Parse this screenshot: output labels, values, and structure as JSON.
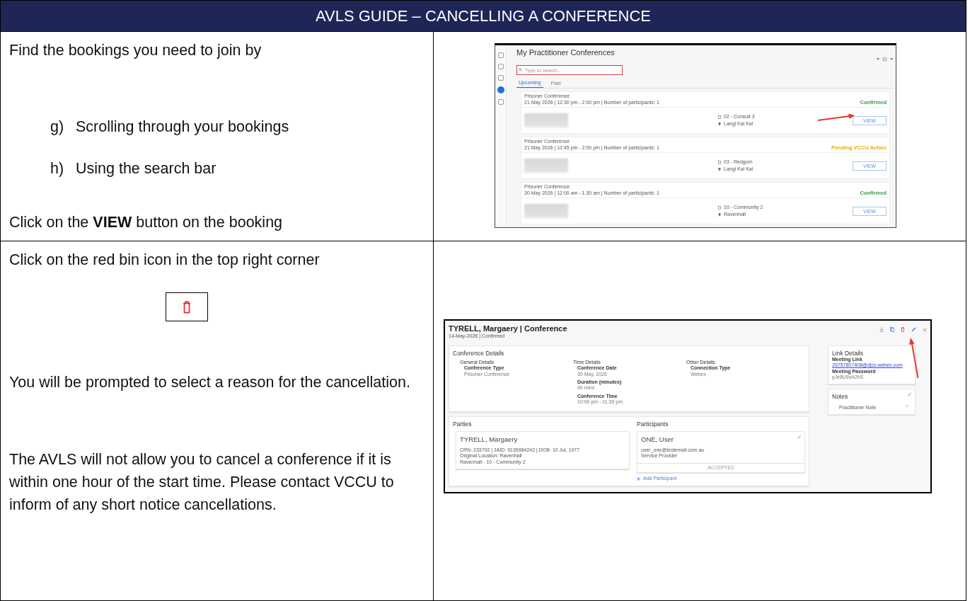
{
  "header": {
    "title": "AVLS GUIDE – CANCELLING A CONFERENCE"
  },
  "guide_rows": [
    {
      "instructions": [
        {
          "kind": "text",
          "text": "Find the bookings you need to join by"
        },
        {
          "kind": "list_item",
          "marker": "g)",
          "text": "Scrolling through your bookings"
        },
        {
          "kind": "list_item",
          "marker": "h)",
          "text": "Using the search bar"
        },
        {
          "kind": "text",
          "text": "Click on the **VIEW** button on the booking"
        }
      ],
      "screenshot": {
        "kind": "bookings",
        "title": "My Practitioner Conferences",
        "search_placeholder": "Type to search...",
        "sidebar": [
          {
            "selected": false
          },
          {
            "selected": false
          },
          {
            "selected": false
          },
          {
            "selected": true
          },
          {
            "selected": false
          }
        ],
        "tabs": [
          {
            "label": "Upcoming",
            "selected": true
          },
          {
            "label": "Past",
            "selected": false
          }
        ],
        "bookings": [
          {
            "type": "Prisoner Conference",
            "when": "21 May 2026 | 12:30 pm - 2:00 pm | Number of participants: 1",
            "status": "Confirmed",
            "color": "#3a9b46",
            "room": "02 - Consult 3",
            "site": "Langi Kal Kal",
            "button": "VIEW",
            "highlighted": true
          },
          {
            "type": "Prisoner Conference",
            "when": "21 May 2026 | 12:45 pm - 2:00 pm | Number of participants: 1",
            "status": "Pending VCCU Action",
            "color": "#f0a800",
            "room": "03 - Redgum",
            "site": "Langi Kal Kal",
            "button": "VIEW",
            "highlighted": false
          },
          {
            "type": "Prisoner Conference",
            "when": "30 May 2026 | 12:00 am - 1:30 am | Number of participants: 1",
            "status": "Confirmed",
            "color": "#3a9b46",
            "room": "10 - Community 2",
            "site": "Ravenhall",
            "button": "VIEW",
            "highlighted": false
          }
        ]
      }
    },
    {
      "instructions": [
        {
          "kind": "text",
          "text": "Click on the red bin icon in the top right corner"
        },
        {
          "kind": "bin_icon"
        },
        {
          "kind": "text",
          "text": "You will be prompted to select a reason for the cancellation."
        },
        {
          "kind": "text",
          "text": "The AVLS will not allow you to cancel a conference if it is within one hour of the start time. Please contact VCCU to inform of any short notice cancellations."
        }
      ],
      "screenshot": {
        "kind": "conference",
        "title": "TYRELL, Margaery | Conference",
        "subtitle": "14-May-2026 | Confirmed",
        "delete_highlighted": true,
        "conference_details": {
          "title": "Conference Details",
          "groups": [
            {
              "title": "General Details",
              "fields": [
                {
                  "label": "Conference Type",
                  "value": "Prisoner Conference"
                }
              ]
            },
            {
              "title": "Time Details",
              "fields": [
                {
                  "label": "Conference Date",
                  "value": "30 May, 2026"
                },
                {
                  "label": "Duration (minutes)",
                  "value": "90 mins"
                },
                {
                  "label": "Conference Time",
                  "value": "10:00 pm - 11:30 pm"
                }
              ]
            },
            {
              "title": "Other Details",
              "fields": [
                {
                  "label": "Connection Type",
                  "value": "Webex"
                }
              ]
            }
          ]
        },
        "parties": {
          "title": "Parties",
          "name": "TYRELL, Margaery",
          "lines": [
            "CRN: 233792 | JAID: 9139984242 | DOB: 10 Jul, 1977",
            "Original Location: Ravenhall",
            "Ravenhall - 10 - Community 2"
          ]
        },
        "participants": {
          "title": "Participants",
          "name": "ONE, User",
          "lines": [
            "user_one@testemail.com.au",
            "Service Provider"
          ],
          "status": "ACCEPTED",
          "add_label": "Add Participant"
        },
        "link_details": {
          "title": "Link Details",
          "fields": [
            {
              "label": "Meeting Link",
              "value": "26757807408@djcs.webex.com",
              "kind": "link"
            },
            {
              "label": "Meeting Password",
              "value": "yJe8U9zA2hS",
              "kind": "text"
            }
          ]
        },
        "notes": {
          "title": "Notes",
          "item": "Practitioner Note"
        }
      }
    }
  ]
}
